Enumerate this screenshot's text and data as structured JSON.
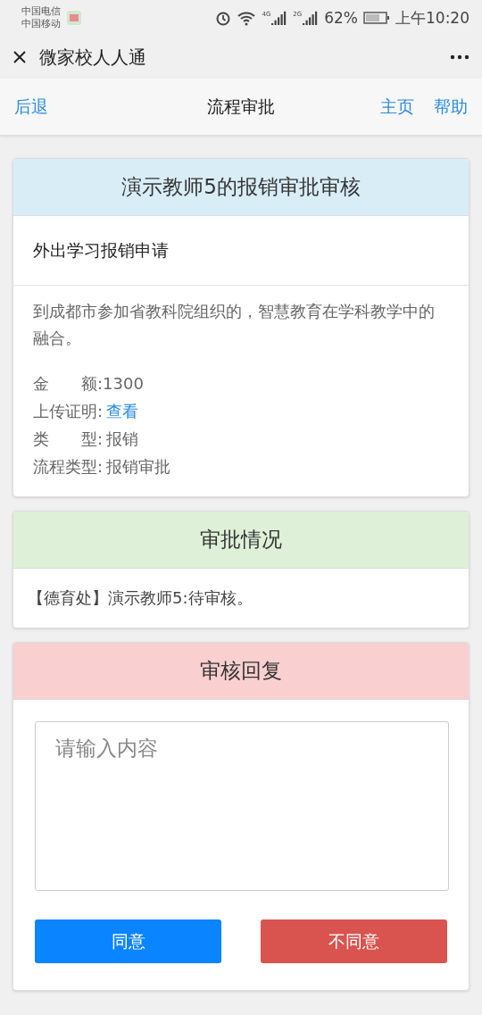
{
  "status_bar": {
    "carriers": [
      "中国电信",
      "中国移动"
    ],
    "signals": [
      "4G",
      "2G"
    ],
    "battery": "62%",
    "time": "上午10:20"
  },
  "window": {
    "title": "微家校人人通"
  },
  "toolbar": {
    "back": "后退",
    "title": "流程审批",
    "links": [
      "主页",
      "帮助"
    ]
  },
  "request": {
    "title": "演示教师5的报销审批审核",
    "subject": "外出学习报销申请",
    "description": "到成都市参加省教科院组织的，智慧教育在学科教学中的融合。",
    "fields": [
      {
        "kind": "text",
        "label": "金　　额:",
        "value": "1300"
      },
      {
        "kind": "link",
        "label": "上传证明:",
        "value": "查看"
      },
      {
        "kind": "text",
        "label": "类　　型:",
        "value": "报销"
      },
      {
        "kind": "text",
        "label": "流程类型:",
        "value": "报销审批"
      }
    ]
  },
  "approval": {
    "title": "审批情况",
    "entries": [
      "【德育处】演示教师5:待审核。"
    ]
  },
  "reply": {
    "title": "审核回复",
    "placeholder": "请输入内容",
    "buttons": [
      {
        "kind": "approve",
        "label": "同意"
      },
      {
        "kind": "reject",
        "label": "不同意"
      }
    ]
  }
}
